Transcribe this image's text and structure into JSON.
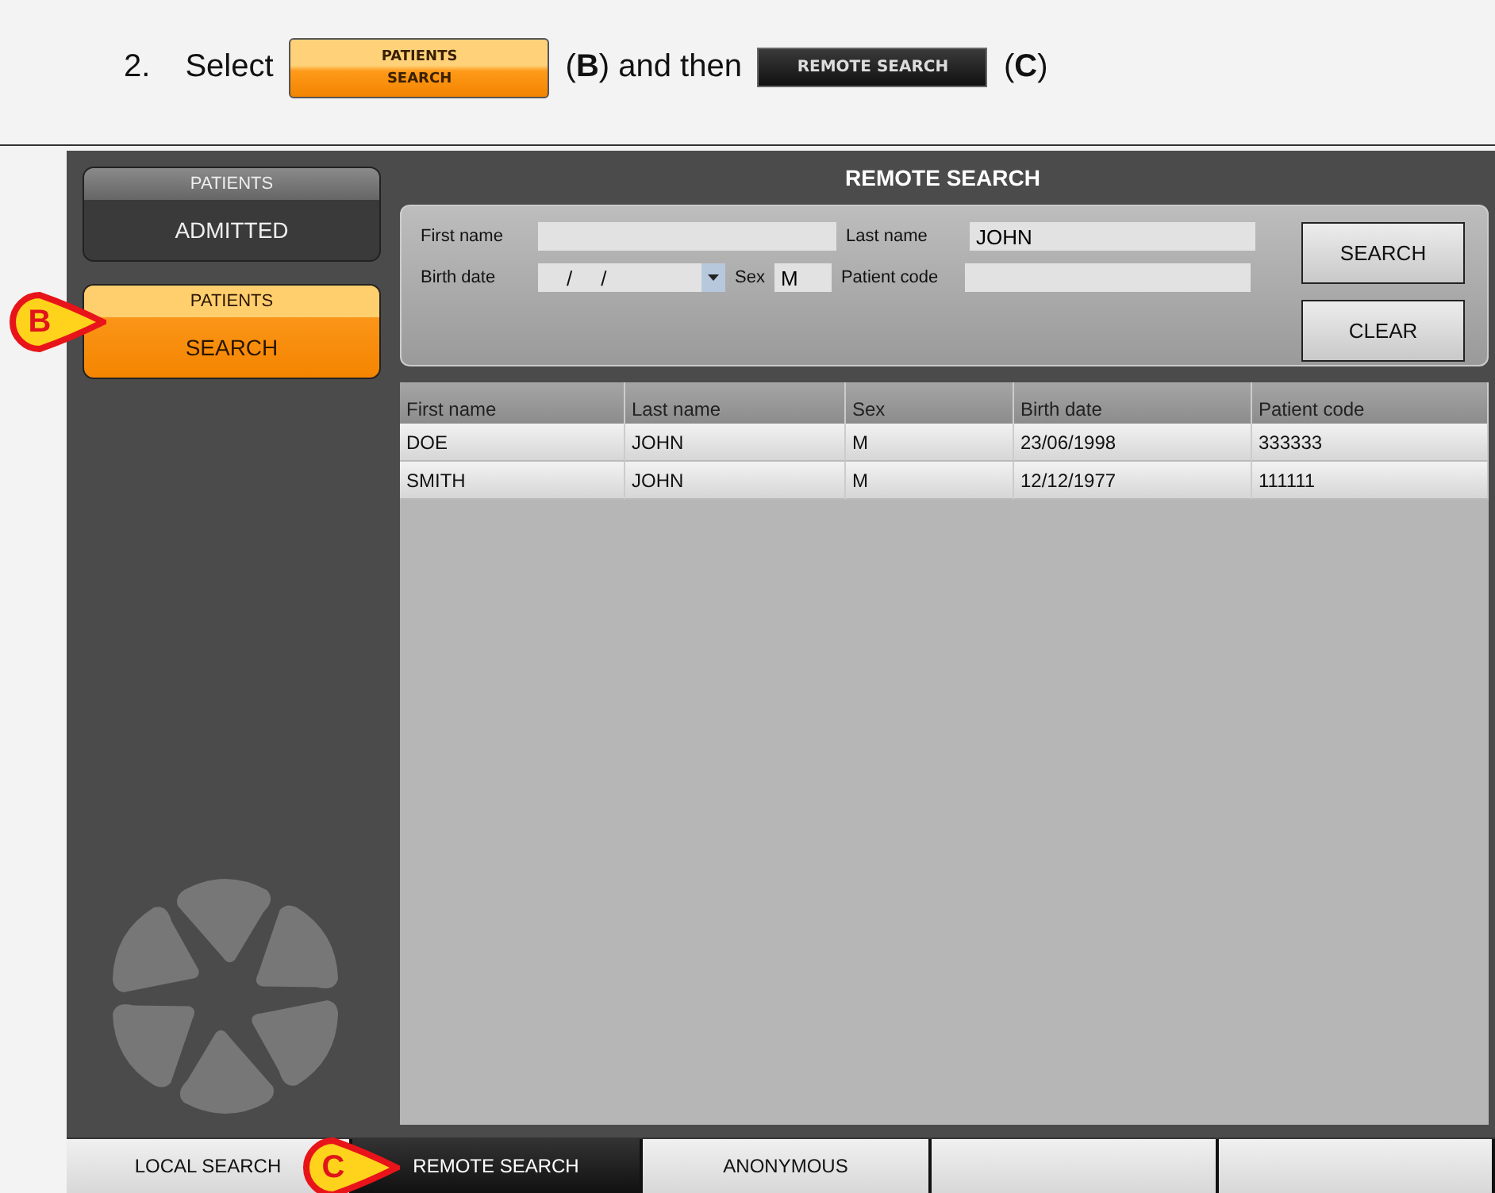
{
  "instruction": {
    "number": "2.",
    "segments": [
      {
        "kind": "text",
        "text": "Select"
      },
      {
        "kind": "orange_button",
        "top": "PATIENTS",
        "bottom": "SEARCH"
      },
      {
        "kind": "text",
        "text": "(**B**) and then"
      },
      {
        "kind": "dark_button",
        "label": "REMOTE SEARCH"
      },
      {
        "kind": "text",
        "text": "(**C**)"
      }
    ]
  },
  "sidebar": {
    "buttons": [
      {
        "top": "PATIENTS",
        "bottom": "ADMITTED",
        "selected": false
      },
      {
        "top": "PATIENTS",
        "bottom": "SEARCH",
        "selected": true
      }
    ]
  },
  "search": {
    "title": "REMOTE SEARCH",
    "first_name": {
      "label": "First name"
    },
    "last_name": {
      "label": "Last name",
      "value": "JOHN"
    },
    "birth_date": {
      "label": "Birth date",
      "value": "/     /"
    },
    "sex": {
      "label": "Sex",
      "value": "M"
    },
    "patient_code": {
      "label": "Patient code"
    },
    "buttons": [
      "SEARCH",
      "CLEAR"
    ]
  },
  "table": {
    "columns": [
      "First name",
      "Last name",
      "Sex",
      "Birth date",
      "Patient code"
    ],
    "rows": [
      [
        "DOE",
        "JOHN",
        "M",
        "23/06/1998",
        "333333"
      ],
      [
        "SMITH",
        "JOHN",
        "M",
        "12/12/1977",
        "111111"
      ]
    ]
  },
  "bottom_tabs": [
    {
      "label": "LOCAL SEARCH",
      "selected": false
    },
    {
      "label": "REMOTE SEARCH",
      "selected": true
    },
    {
      "label": "ANONYMOUS",
      "selected": false
    },
    {
      "selected": false
    },
    {
      "selected": false
    }
  ],
  "callouts": [
    {
      "label": "B"
    },
    {
      "label": "C"
    }
  ]
}
